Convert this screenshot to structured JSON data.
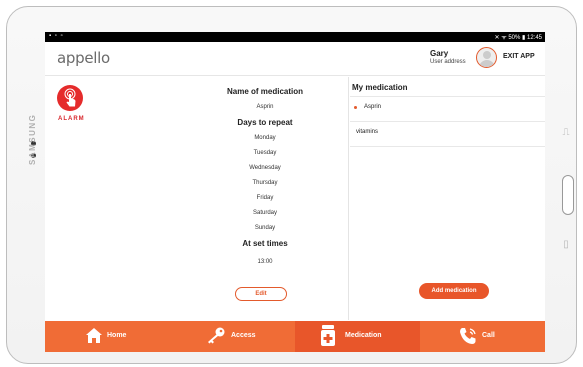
{
  "device": {
    "brand": "SAMSUNG"
  },
  "statusbar": {
    "left_icons": "▪ ▫ ▫",
    "right": "✕ ᯤ 50% ▮ 12:45"
  },
  "header": {
    "logo": "appello",
    "user_name": "Gary",
    "user_address": "User address",
    "exit_label": "EXIT APP"
  },
  "alarm": {
    "label": "ALARM",
    "icon": "alarm-touch-icon"
  },
  "details": {
    "name_heading": "Name of medication",
    "name_value": "Asprin",
    "days_heading": "Days to repeat",
    "days": [
      "Monday",
      "Tuesday",
      "Wednesday",
      "Thursday",
      "Friday",
      "Saturday",
      "Sunday"
    ],
    "times_heading": "At set times",
    "time_value": "13:00",
    "edit_label": "Edit"
  },
  "medications": {
    "title": "My medication",
    "items": [
      {
        "label": "Asprin",
        "selected": true
      },
      {
        "label": "vitamins",
        "selected": false
      }
    ],
    "add_label": "Add medication"
  },
  "nav": {
    "items": [
      {
        "label": "Home",
        "icon": "home-icon",
        "active": false
      },
      {
        "label": "Access",
        "icon": "key-icon",
        "active": false
      },
      {
        "label": "Medication",
        "icon": "medication-icon",
        "active": true
      },
      {
        "label": "Call",
        "icon": "phone-icon",
        "active": false
      }
    ]
  },
  "colors": {
    "accent": "#e8562a",
    "nav_bg": "#f06c36",
    "alarm_red": "#e52b2b"
  }
}
